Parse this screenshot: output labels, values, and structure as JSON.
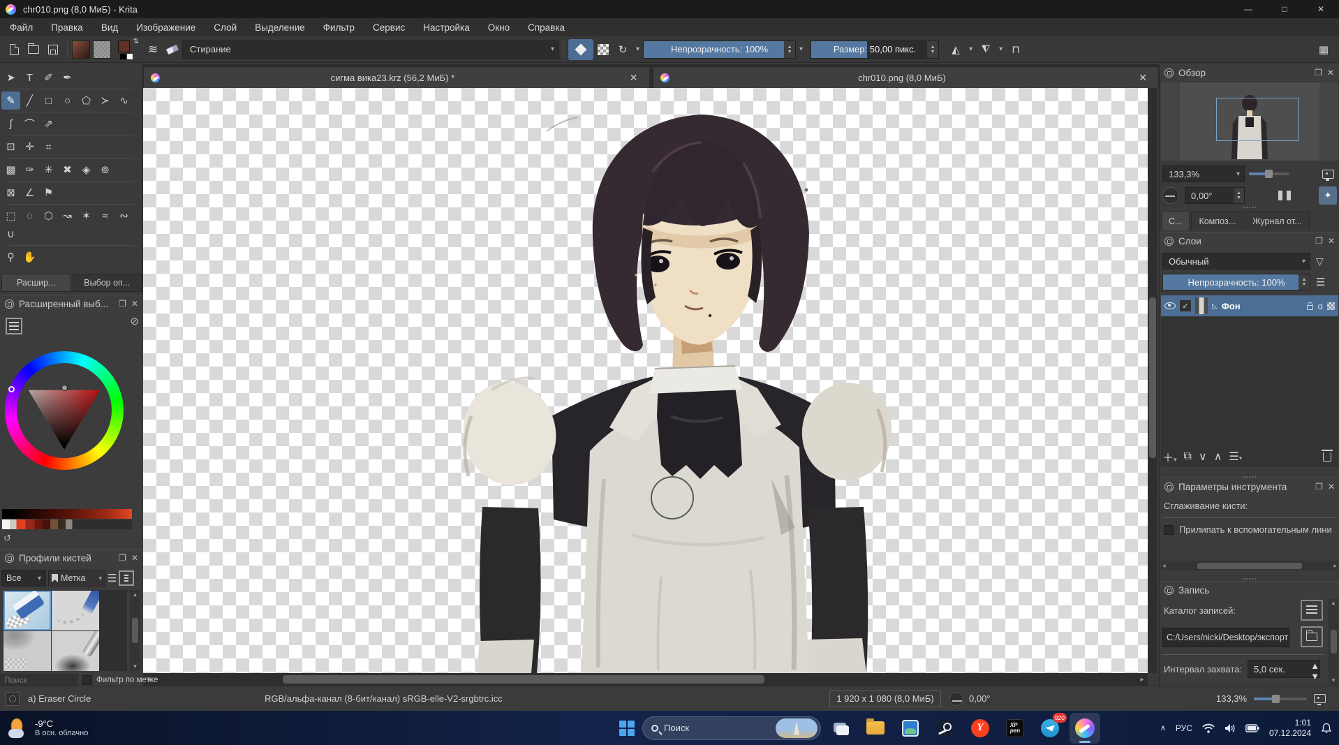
{
  "window": {
    "title": "chr010.png (8,0 МиБ)  - Krita"
  },
  "menu": {
    "items": [
      "Файл",
      "Правка",
      "Вид",
      "Изображение",
      "Слой",
      "Выделение",
      "Фильтр",
      "Сервис",
      "Настройка",
      "Окно",
      "Справка"
    ]
  },
  "toolbar": {
    "preset_name": "Стирание",
    "opacity": "Непрозрачность: 100%",
    "size": "Размер: 50,00 пикс."
  },
  "doc_tabs": [
    {
      "label": "сигма вика23.krz (56,2 МиБ) *"
    },
    {
      "label": "chr010.png (8,0 МиБ)"
    }
  ],
  "toolbox": {
    "groups": [
      [
        {
          "name": "select-shapes",
          "glyph": "➤"
        },
        {
          "name": "text",
          "glyph": "T"
        },
        {
          "name": "edit-shapes",
          "glyph": "✐"
        },
        {
          "name": "calligraphy",
          "glyph": "✒"
        }
      ],
      [
        {
          "name": "freehand-brush",
          "glyph": "✎",
          "active": true
        },
        {
          "name": "line",
          "glyph": "╱"
        },
        {
          "name": "rectangle",
          "glyph": "□"
        },
        {
          "name": "ellipse",
          "glyph": "○"
        },
        {
          "name": "polygon",
          "glyph": "⬠"
        },
        {
          "name": "polyline",
          "glyph": "≻"
        },
        {
          "name": "bezier-curve",
          "glyph": "∿"
        }
      ],
      [
        {
          "name": "dynamic-brush",
          "glyph": "ʃ"
        },
        {
          "name": "arc",
          "glyph": "⌒"
        },
        {
          "name": "multibrush",
          "glyph": "⇗"
        }
      ],
      [
        {
          "name": "transform",
          "glyph": "⊡"
        },
        {
          "name": "move",
          "glyph": "✛"
        },
        {
          "name": "crop",
          "glyph": "⌗"
        }
      ],
      [
        {
          "name": "gradient",
          "glyph": "▩"
        },
        {
          "name": "color-sampler",
          "glyph": "✑"
        },
        {
          "name": "smart-patch",
          "glyph": "✳"
        },
        {
          "name": "colorize-mask",
          "glyph": "✖"
        },
        {
          "name": "fill",
          "glyph": "◈"
        },
        {
          "name": "enclose-fill",
          "glyph": "⊚"
        }
      ],
      [
        {
          "name": "assistants",
          "glyph": "⊠"
        },
        {
          "name": "measure",
          "glyph": "∠"
        },
        {
          "name": "reference-images",
          "glyph": "⚑"
        }
      ],
      [
        {
          "name": "rectangular-selection",
          "glyph": "⬚"
        },
        {
          "name": "elliptical-selection",
          "glyph": "◌"
        },
        {
          "name": "polygonal-selection",
          "glyph": "⬡"
        },
        {
          "name": "freehand-selection",
          "glyph": "↝"
        },
        {
          "name": "contiguous-selection",
          "glyph": "✶"
        },
        {
          "name": "similar-color-selection",
          "glyph": "≈"
        },
        {
          "name": "bezier-selection",
          "glyph": "∾"
        },
        {
          "name": "magnetic-selection",
          "glyph": "∪"
        }
      ],
      [
        {
          "name": "zoom",
          "glyph": "⚲"
        },
        {
          "name": "pan",
          "glyph": "✋"
        }
      ]
    ]
  },
  "left_dock": {
    "expand_tab": "Расшир...",
    "options_tab": "Выбор оп...",
    "selector": {
      "title": "Расширенный выб..."
    },
    "presets": {
      "title": "Профили кистей",
      "filter_all": "Все",
      "tag_label": "Метка",
      "search": "Поиск",
      "filter_by_tag": "Фильтр по метке"
    }
  },
  "right_dock": {
    "overview": {
      "title": "Обзор",
      "zoom": "133,3%",
      "angle": "0,00°",
      "tabs": [
        "С...",
        "Композ...",
        "Журнал от..."
      ]
    },
    "layers": {
      "title": "Слои",
      "blend": "Обычный",
      "opacity": "Непрозрачность:  100%",
      "layer_name": "Фон"
    },
    "tool_options": {
      "title": "Параметры инструмента",
      "smoothing": "Сглаживание кисти:",
      "snap": "Прилипать к вспомогательным лини"
    },
    "recorder": {
      "title": "Запись",
      "dir_label": "Каталог записей:",
      "dir": "C:/Users/nicki/Desktop/экспорт",
      "interval_label": "Интервал захвата:",
      "interval": "5,0 сек."
    }
  },
  "statusbar": {
    "tool": "a) Eraser Circle",
    "profile": "RGB/альфа-канал (8-бит/канал)  sRGB-elle-V2-srgbtrc.icc",
    "size": "1 920 x 1 080 (8,0 МиБ)",
    "angle": "0,00°",
    "zoom": "133,3%"
  },
  "taskbar": {
    "temp": "-9°C",
    "weather": "В осн. облачно",
    "search": "Поиск",
    "lang": "РУС",
    "time": "1:01",
    "date": "07.12.2024",
    "badge": "920"
  },
  "colors": {
    "accent_blue": "#54789f",
    "selection_blue": "#4d6e94",
    "taskbar_bg": "#0e1b3a"
  }
}
